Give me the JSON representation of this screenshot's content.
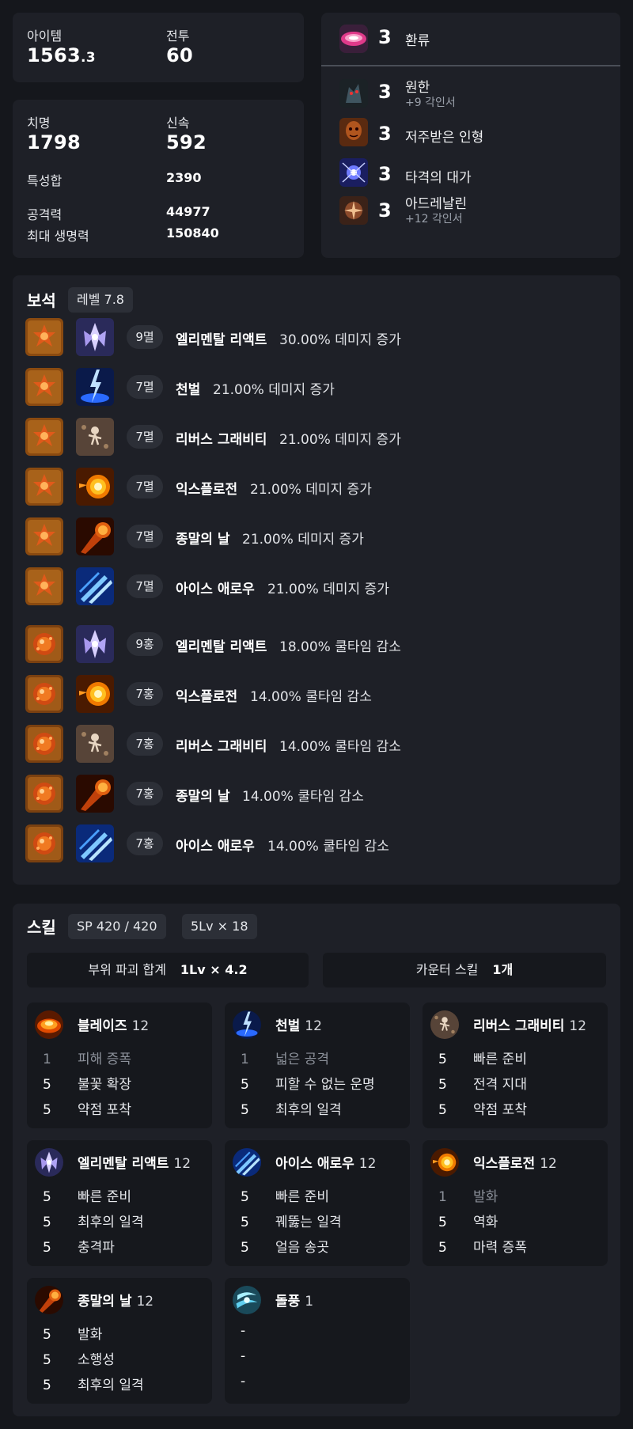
{
  "stats": {
    "item_label": "아이템",
    "item_value": "1563",
    "item_value_decimal": ".3",
    "battle_label": "전투",
    "battle_value": "60",
    "crit_label": "치명",
    "crit_value": "1798",
    "swift_label": "신속",
    "swift_value": "592",
    "trait_sum_label": "특성합",
    "trait_sum_value": "2390",
    "attack_label": "공격력",
    "attack_value": "44977",
    "hp_label": "최대 생명력",
    "hp_value": "150840"
  },
  "engravings": [
    {
      "level": "3",
      "name": "환류",
      "sub": "",
      "icon": "vortex-icon"
    },
    {
      "level": "3",
      "name": "원한",
      "sub": "+9 각인서",
      "icon": "grudge-icon"
    },
    {
      "level": "3",
      "name": "저주받은 인형",
      "sub": "",
      "icon": "cursed-doll-icon"
    },
    {
      "level": "3",
      "name": "타격의 대가",
      "sub": "",
      "icon": "hit-master-icon"
    },
    {
      "level": "3",
      "name": "아드레날린",
      "sub": "+12 각인서",
      "icon": "adrenaline-icon"
    }
  ],
  "gems": {
    "title": "보석",
    "level_tag": "레벨 7.8",
    "items": [
      {
        "badge": "9멸",
        "skill": "엘리멘탈 리액트",
        "effect": "30.00% 데미지 증가",
        "gem": "annihilation",
        "skill_icon": "crystal"
      },
      {
        "badge": "7멸",
        "skill": "천벌",
        "effect": "21.00% 데미지 증가",
        "gem": "annihilation",
        "skill_icon": "lightning"
      },
      {
        "badge": "7멸",
        "skill": "리버스 그래비티",
        "effect": "21.00% 데미지 증가",
        "gem": "annihilation",
        "skill_icon": "gravity"
      },
      {
        "badge": "7멸",
        "skill": "익스플로전",
        "effect": "21.00% 데미지 증가",
        "gem": "annihilation",
        "skill_icon": "fireball"
      },
      {
        "badge": "7멸",
        "skill": "종말의 날",
        "effect": "21.00% 데미지 증가",
        "gem": "annihilation",
        "skill_icon": "meteor"
      },
      {
        "badge": "7멸",
        "skill": "아이스 애로우",
        "effect": "21.00% 데미지 증가",
        "gem": "annihilation",
        "skill_icon": "ice"
      },
      {
        "badge": "9홍",
        "skill": "엘리멘탈 리액트",
        "effect": "18.00% 쿨타임 감소",
        "gem": "crimson",
        "skill_icon": "crystal"
      },
      {
        "badge": "7홍",
        "skill": "익스플로전",
        "effect": "14.00% 쿨타임 감소",
        "gem": "crimson",
        "skill_icon": "fireball"
      },
      {
        "badge": "7홍",
        "skill": "리버스 그래비티",
        "effect": "14.00% 쿨타임 감소",
        "gem": "crimson",
        "skill_icon": "gravity"
      },
      {
        "badge": "7홍",
        "skill": "종말의 날",
        "effect": "14.00% 쿨타임 감소",
        "gem": "crimson",
        "skill_icon": "meteor"
      },
      {
        "badge": "7홍",
        "skill": "아이스 애로우",
        "effect": "14.00% 쿨타임 감소",
        "gem": "crimson",
        "skill_icon": "ice"
      }
    ]
  },
  "skills": {
    "title": "스킬",
    "sp_tag": "SP 420 / 420",
    "lv_tag": "5Lv × 18",
    "destruction_label": "부위 파괴 합계",
    "destruction_value": "1Lv × 4.2",
    "counter_label": "카운터 스킬",
    "counter_value": "1개",
    "cards": [
      {
        "name": "블레이즈",
        "level": "12",
        "icon": "blaze",
        "tripods": [
          {
            "lv": "1",
            "name": "피해 증폭",
            "dim": true
          },
          {
            "lv": "5",
            "name": "불꽃 확장"
          },
          {
            "lv": "5",
            "name": "약점 포착"
          }
        ]
      },
      {
        "name": "천벌",
        "level": "12",
        "icon": "lightning",
        "tripods": [
          {
            "lv": "1",
            "name": "넓은 공격",
            "dim": true
          },
          {
            "lv": "5",
            "name": "피할 수 없는 운명"
          },
          {
            "lv": "5",
            "name": "최후의 일격"
          }
        ]
      },
      {
        "name": "리버스 그래비티",
        "level": "12",
        "icon": "gravity",
        "tripods": [
          {
            "lv": "5",
            "name": "빠른 준비"
          },
          {
            "lv": "5",
            "name": "전격 지대"
          },
          {
            "lv": "5",
            "name": "약점 포착"
          }
        ]
      },
      {
        "name": "엘리멘탈 리액트",
        "level": "12",
        "icon": "crystal",
        "tripods": [
          {
            "lv": "5",
            "name": "빠른 준비"
          },
          {
            "lv": "5",
            "name": "최후의 일격"
          },
          {
            "lv": "5",
            "name": "충격파"
          }
        ]
      },
      {
        "name": "아이스 애로우",
        "level": "12",
        "icon": "ice",
        "tripods": [
          {
            "lv": "5",
            "name": "빠른 준비"
          },
          {
            "lv": "5",
            "name": "꿰뚫는 일격"
          },
          {
            "lv": "5",
            "name": "얼음 송곳"
          }
        ]
      },
      {
        "name": "익스플로전",
        "level": "12",
        "icon": "fireball",
        "tripods": [
          {
            "lv": "1",
            "name": "발화",
            "dim": true
          },
          {
            "lv": "5",
            "name": "역화"
          },
          {
            "lv": "5",
            "name": "마력 증폭"
          }
        ]
      },
      {
        "name": "종말의 날",
        "level": "12",
        "icon": "meteor",
        "tripods": [
          {
            "lv": "5",
            "name": "발화"
          },
          {
            "lv": "5",
            "name": "소행성"
          },
          {
            "lv": "5",
            "name": "최후의 일격"
          }
        ]
      },
      {
        "name": "돌풍",
        "level": "1",
        "icon": "gust",
        "tripods": [
          {
            "lv": "-",
            "name": ""
          },
          {
            "lv": "-",
            "name": ""
          },
          {
            "lv": "-",
            "name": ""
          }
        ]
      }
    ]
  }
}
